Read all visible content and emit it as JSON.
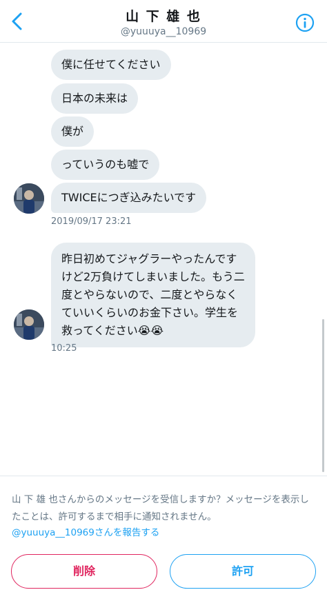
{
  "header": {
    "title": "山 下 雄 也",
    "handle": "@yuuuya__10969"
  },
  "messages_group1": [
    "僕に任せてください",
    "日本の未来は",
    "僕が",
    "っていうのも嘘で",
    "TWICEにつぎ込みたいです"
  ],
  "timestamp1": "2019/09/17 23:21",
  "message2": "昨日初めてジャグラーやったんですけど2万負けてしまいました。もう二度とやらないので、二度とやらなくていいくらいのお金下さい。学生を救ってください😭😭",
  "timestamp2": "10:25",
  "notice": {
    "text": "山 下 雄 也さんからのメッセージを受信しますか？メッセージを表示したことは、許可するまで相手に通知されません。",
    "report_link": "@yuuuya__10969さんを報告する"
  },
  "actions": {
    "delete_label": "削除",
    "allow_label": "許可"
  },
  "colors": {
    "accent": "#1da1f2",
    "danger": "#e0245e",
    "bubble": "#e6ecf0",
    "muted": "#657786"
  },
  "icons": {
    "back": "chevron-left-icon",
    "info": "info-icon"
  }
}
